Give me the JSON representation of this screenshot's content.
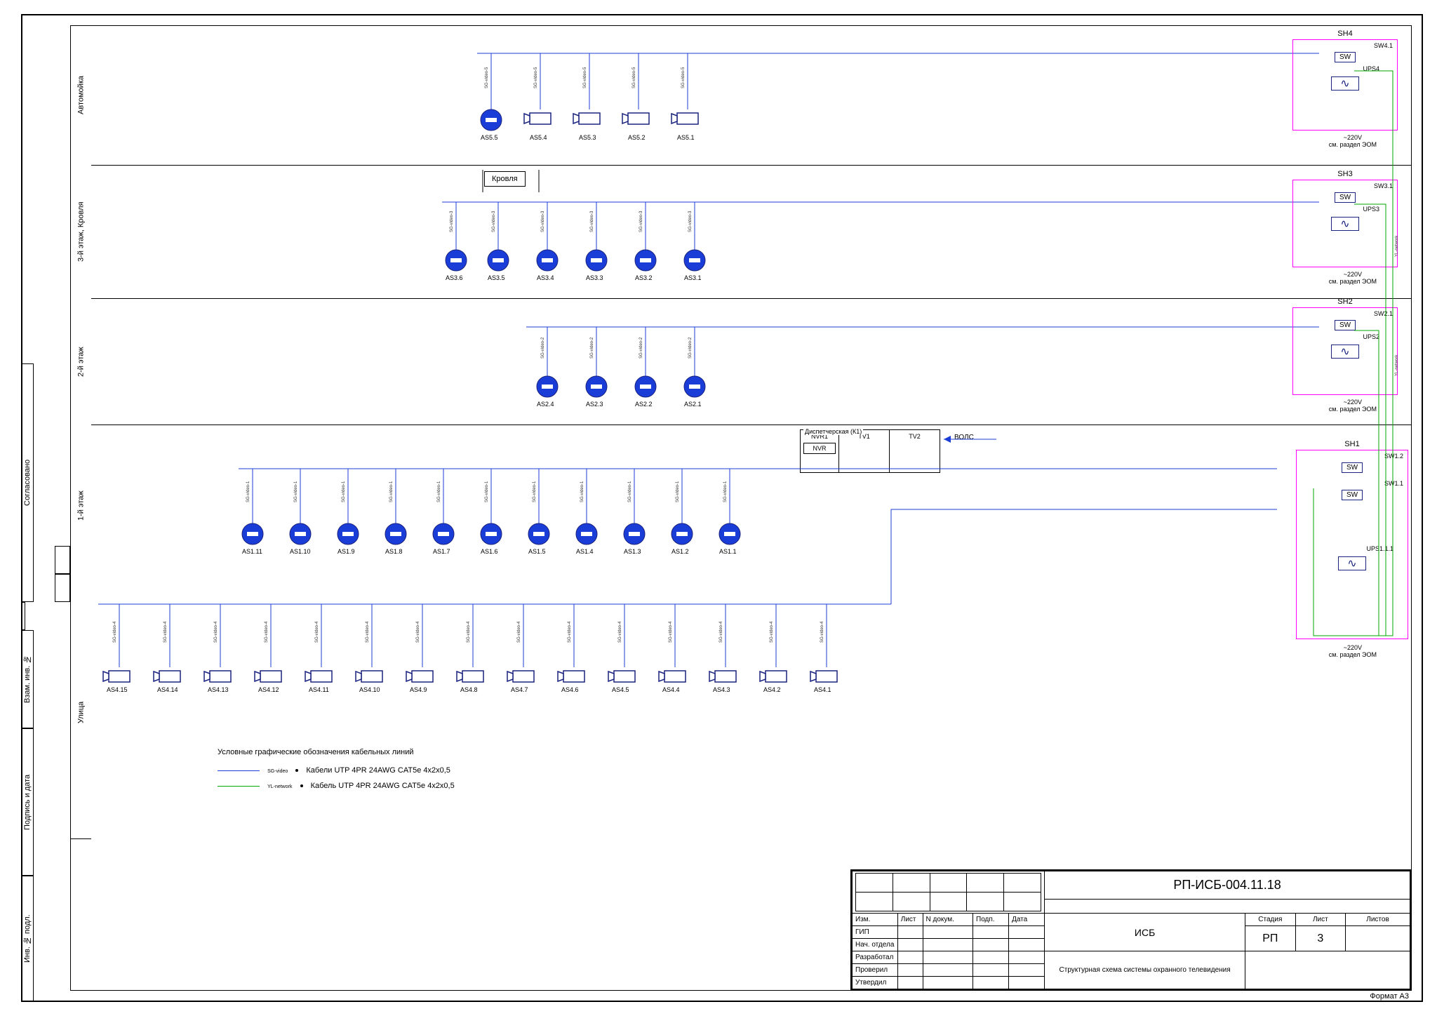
{
  "rows": [
    {
      "label": "Автомойка"
    },
    {
      "label": "3-й этаж, Кровля"
    },
    {
      "label": "2-й этаж"
    },
    {
      "label": "1-й этаж"
    },
    {
      "label": "Улица"
    }
  ],
  "side_stamp": [
    "Инв. № подл.",
    "Подпись и дата",
    "Взам. инв. №",
    "",
    "Согласовано"
  ],
  "roof_box": "Кровля",
  "dispatch": {
    "title": "Диспетчерская (К1)",
    "nvr1": "NVR1",
    "nvr": "NVR",
    "tv1": "TV1",
    "tv2": "TV2",
    "vols": "ВОЛС"
  },
  "sh_blocks": [
    {
      "name": "SH4",
      "sw_id": "SW4.1",
      "sw": "SW",
      "ups": "UPS4",
      "power": "~220V",
      "ref": "см. раздел ЭОМ"
    },
    {
      "name": "SH3",
      "sw_id": "SW3.1",
      "sw": "SW",
      "ups": "UPS3",
      "power": "~220V",
      "ref": "см. раздел ЭОМ"
    },
    {
      "name": "SH2",
      "sw_id": "SW2.1",
      "sw": "SW",
      "ups": "UPS2",
      "power": "~220V",
      "ref": "см. раздел ЭОМ"
    },
    {
      "name": "SH1",
      "sw_id1": "SW1.2",
      "sw_id2": "SW1.1",
      "sw": "SW",
      "ups": "UPS1.1.1",
      "power": "~220V",
      "ref": "см. раздел ЭОМ"
    }
  ],
  "cameras_row1": [
    "AS5.5",
    "AS5.4",
    "AS5.3",
    "AS5.2",
    "AS5.1"
  ],
  "cameras_row2": [
    "AS3.6",
    "AS3.5",
    "AS3.4",
    "AS3.3",
    "AS3.2",
    "AS3.1"
  ],
  "cameras_row3": [
    "AS2.4",
    "AS2.3",
    "AS2.2",
    "AS2.1"
  ],
  "cameras_row4": [
    "AS1.11",
    "AS1.10",
    "AS1.9",
    "AS1.8",
    "AS1.7",
    "AS1.6",
    "AS1.5",
    "AS1.4",
    "AS1.3",
    "AS1.2",
    "AS1.1"
  ],
  "cameras_row5": [
    "AS4.15",
    "AS4.14",
    "AS4.13",
    "AS4.12",
    "AS4.11",
    "AS4.10",
    "AS4.9",
    "AS4.8",
    "AS4.7",
    "AS4.6",
    "AS4.5",
    "AS4.4",
    "AS4.3",
    "AS4.2",
    "AS4.1"
  ],
  "cable_notes_r1": [
    "SG-video-5",
    "SG-video-5",
    "SG-video-5",
    "SG-video-5",
    "SG-video-5"
  ],
  "cable_notes_r2": [
    "SG-video-3",
    "SG-video-3",
    "SG-video-3",
    "SG-video-3",
    "SG-video-3",
    "SG-video-3"
  ],
  "cable_notes_r3": [
    "SG-video-2",
    "SG-video-2",
    "SG-video-2",
    "SG-video-2"
  ],
  "cable_notes_r4": [
    "SG-video-1",
    "SG-video-1",
    "SG-video-1",
    "SG-video-1",
    "SG-video-1",
    "SG-video-1",
    "SG-video-1",
    "SG-video-1",
    "SG-video-1",
    "SG-video-1",
    "SG-video-1"
  ],
  "cable_notes_r5": [
    "SG-video-4",
    "SG-video-4",
    "SG-video-4",
    "SG-video-4",
    "SG-video-4",
    "SG-video-4",
    "SG-video-4",
    "SG-video-4",
    "SG-video-4",
    "SG-video-4",
    "SG-video-4",
    "SG-video-4",
    "SG-video-4",
    "SG-video-4",
    "SG-video-4"
  ],
  "network_label": "YL-network",
  "legend": {
    "title": "Условные графические обозначения кабельных линий",
    "line1_label": "SG-video",
    "line1_text": "Кабели UTP 4PR 24AWG CAT5e 4x2x0,5",
    "line2_label": "YL-network",
    "line2_text": "Кабель UTP 4PR 24AWG CAT5e 4x2x0,5"
  },
  "title_block": {
    "doc_no": "РП-ИСБ-004.11.18",
    "cols_rev": [
      "Изм.",
      "Лист",
      "N докум.",
      "Подп.",
      "Дата"
    ],
    "rows_roles": [
      "ГИП",
      "Нач. отдела",
      "Разработал",
      "Проверил",
      "Утвердил"
    ],
    "project": "ИСБ",
    "subtitle": "Структурная схема системы охранного телевидения",
    "stage_h": "Стадия",
    "stage": "РП",
    "sheet_h": "Лист",
    "sheet": "3",
    "sheets_h": "Листов",
    "sheets": ""
  },
  "format": "Формат А3"
}
